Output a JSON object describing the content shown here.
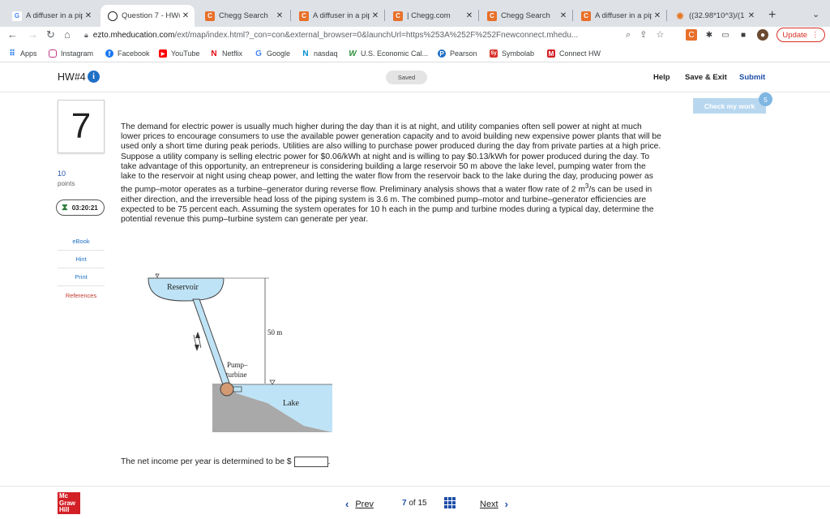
{
  "browser": {
    "tabs": [
      {
        "title": "A diffuser in a pip",
        "icon": "google-icon",
        "active": false
      },
      {
        "title": "Question 7 - HW#",
        "icon": "mcgraw-question-icon",
        "active": true
      },
      {
        "title": "Chegg Search",
        "icon": "chegg-icon",
        "active": false
      },
      {
        "title": "A diffuser in a pip",
        "icon": "chegg-icon",
        "active": false
      },
      {
        "title": "| Chegg.com",
        "icon": "chegg-icon",
        "active": false
      },
      {
        "title": "Chegg Search",
        "icon": "chegg-icon",
        "active": false
      },
      {
        "title": "A diffuser in a pip",
        "icon": "chegg-icon",
        "active": false
      },
      {
        "title": "((32.98*10^3)/(1",
        "icon": "wolfram-icon",
        "active": false
      }
    ],
    "url_host": "ezto.mheducation.com",
    "url_path": "/ext/map/index.html?_con=con&external_browser=0&launchUrl=https%253A%252F%252Fnewconnect.mhedu...",
    "update_label": "Update",
    "bookmarks": [
      {
        "label": "Apps",
        "icon": "apps-grid-icon"
      },
      {
        "label": "Instagram",
        "icon": "instagram-icon"
      },
      {
        "label": "Facebook",
        "icon": "facebook-icon"
      },
      {
        "label": "YouTube",
        "icon": "youtube-icon"
      },
      {
        "label": "Netflix",
        "icon": "netflix-icon"
      },
      {
        "label": "Google",
        "icon": "google-icon"
      },
      {
        "label": "nasdaq",
        "icon": "nasdaq-icon"
      },
      {
        "label": "U.S. Economic Cal...",
        "icon": "wsj-icon"
      },
      {
        "label": "Pearson",
        "icon": "pearson-icon"
      },
      {
        "label": "Symbolab",
        "icon": "symbolab-icon"
      },
      {
        "label": "Connect HW",
        "icon": "mcgraw-icon"
      }
    ]
  },
  "header": {
    "title": "HW#4",
    "saved": "Saved",
    "help": "Help",
    "save_exit": "Save & Exit",
    "submit": "Submit"
  },
  "question": {
    "number": "7",
    "points_value": "10",
    "points_label": "points",
    "timer": "03:20:21",
    "check_my_work": "Check my work",
    "check_badge": "5",
    "side_links": [
      "eBook",
      "Hint",
      "Print",
      "References"
    ],
    "paragraph1": "The demand for electric power is usually much higher during the day than it is at night, and utility companies often sell power at night at much lower prices to encourage consumers to use the available power generation capacity and to avoid building new expensive power plants that will be used only a short time during peak periods. Utilities are also willing to purchase power produced during the day from private parties at a high price.",
    "paragraph2_before_sup": "Suppose a utility company is selling electric power for $0.06/kWh at night and is willing to pay $0.13/kWh for power produced during the day. To take advantage of this opportunity, an entrepreneur is considering building a large reservoir 50 m above the lake level, pumping water from the lake to the reservoir at night using cheap power, and letting the water flow from the reservoir back to the lake during the day, producing power as the pump–motor operates as a turbine–generator during reverse flow. Preliminary analysis shows that a water flow rate of 2 m",
    "paragraph2_sup": "3",
    "paragraph2_after_sup": "/s can be used in either direction, and the irreversible head loss of the piping system is 3.6 m. The combined pump–motor and turbine–generator efficiencies are expected to be 75 percent each. Assuming the system operates for 10 h each in the pump and turbine modes during a typical day, determine the potential revenue this pump–turbine system can generate per year.",
    "figure": {
      "reservoir_label": "Reservoir",
      "height_label": "50 m",
      "pump_label_1": "Pump–",
      "pump_label_2": "turbine",
      "lake_label": "Lake"
    },
    "answer_prompt": "The net income per year is determined to be $",
    "answer_value": "",
    "answer_suffix": "."
  },
  "footer": {
    "logo_line1": "Mc",
    "logo_line2": "Graw",
    "logo_line3": "Hill",
    "prev": "Prev",
    "page_current": "7",
    "page_of": "of 15",
    "next": "Next"
  },
  "colors": {
    "accent_blue": "#1f4fa8",
    "water_blue": "#bfe3f6",
    "ground_gray": "#a9a9a9",
    "brand_red": "#d31f26"
  }
}
